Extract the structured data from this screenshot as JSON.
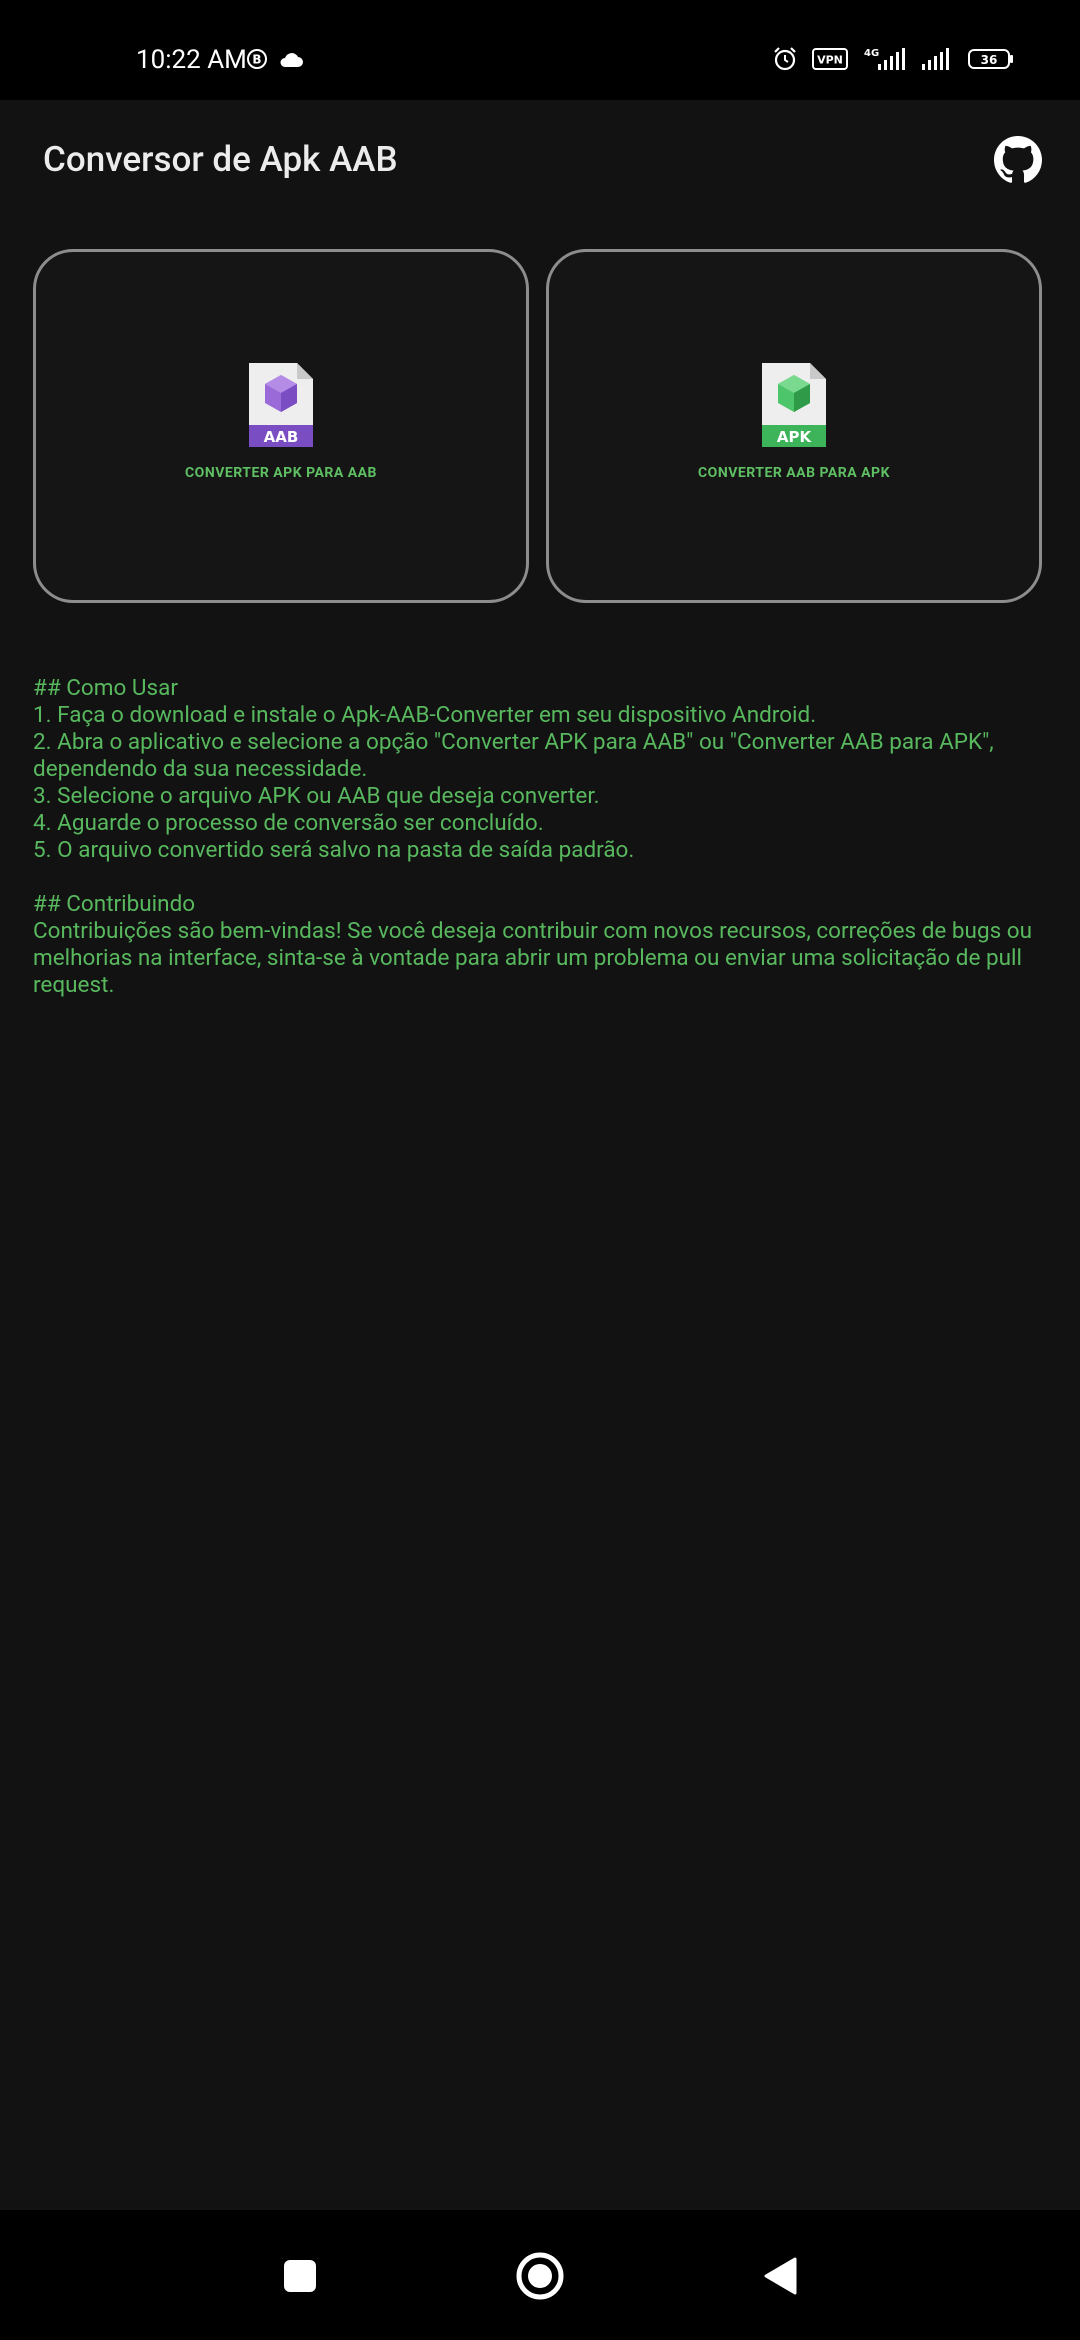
{
  "status_bar": {
    "time": "10:22 AM",
    "battery": "36",
    "network": "4G"
  },
  "app_bar": {
    "title": "Conversor de Apk AAB",
    "github_icon": "github-icon"
  },
  "cards": [
    {
      "icon": "aab-file-icon",
      "label": "CONVERTER APK PARA AAB",
      "badge": "AAB",
      "color": "#7a4dc2"
    },
    {
      "icon": "apk-file-icon",
      "label": "CONVERTER AAB PARA APK",
      "badge": "APK",
      "color": "#3db35a"
    }
  ],
  "readme": {
    "usage_heading": "## Como Usar",
    "usage_steps": [
      "1. Faça o download e instale o Apk-AAB-Converter em seu dispositivo Android.",
      "2. Abra o aplicativo e selecione a opção \"Converter APK para AAB\" ou \"Converter AAB para APK\", dependendo da sua necessidade.",
      "3. Selecione o arquivo APK ou AAB que deseja converter.",
      "4. Aguarde o processo de conversão ser concluído.",
      "5. O arquivo convertido será salvo na pasta de saída padrão."
    ],
    "contrib_heading": "## Contribuindo",
    "contrib_text": "Contribuições são bem-vindas! Se você deseja contribuir com novos recursos, correções de bugs ou melhorias na interface, sinta-se à vontade para abrir um problema ou enviar uma solicitação de pull request."
  },
  "colors": {
    "background": "#121212",
    "accent_green": "#58b85e",
    "card_border": "#8d8d8d"
  }
}
